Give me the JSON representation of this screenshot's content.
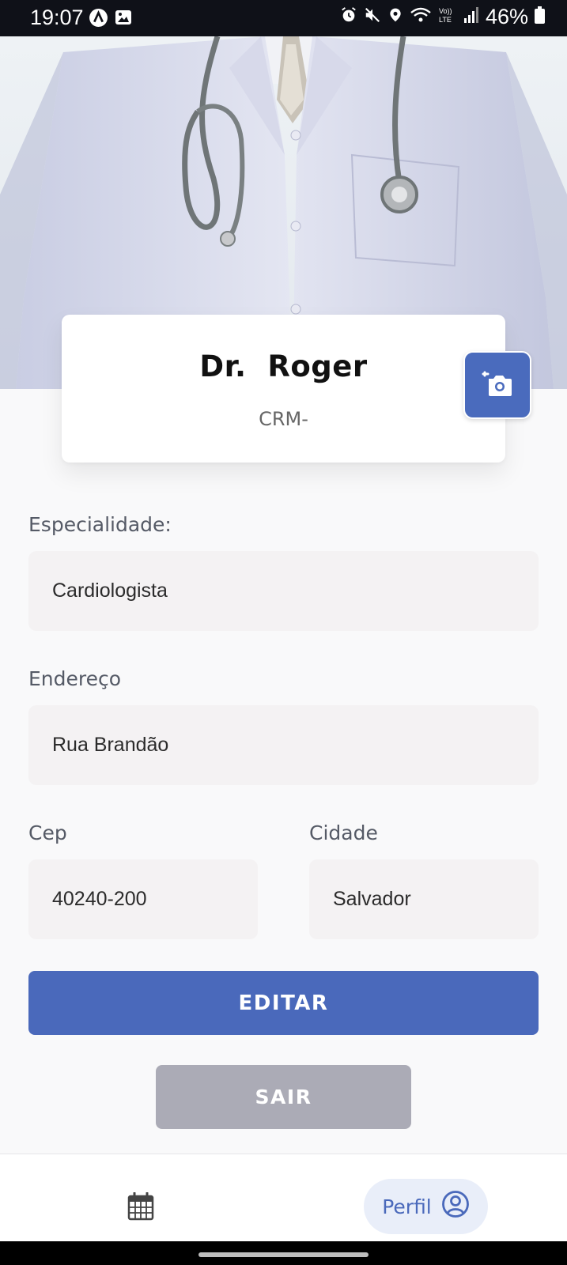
{
  "status_bar": {
    "time": "19:07",
    "battery": "46%",
    "icons": [
      "a-badge-icon",
      "image-icon",
      "alarm-icon",
      "mute-icon",
      "location-icon",
      "wifi-icon",
      "volte-icon",
      "signal-icon",
      "battery-icon"
    ]
  },
  "hero": {
    "image": "doctor-coat-stethoscope-photo"
  },
  "profile": {
    "name": "Dr.  Roger",
    "crm": "CRM-",
    "photo_button_icon": "add-photo-camera-icon"
  },
  "form": {
    "especialidade": {
      "label": "Especialidade:",
      "value": "Cardiologista"
    },
    "endereco": {
      "label": "Endereço",
      "value": "Rua Brandão"
    },
    "cep": {
      "label": "Cep",
      "value": "40240-200"
    },
    "cidade": {
      "label": "Cidade",
      "value": "Salvador"
    }
  },
  "actions": {
    "edit_label": "EDITAR",
    "logout_label": "SAIR"
  },
  "bottom_nav": {
    "calendar_icon": "calendar-icon",
    "profile_label": "Perfil",
    "profile_icon": "user-circle-icon"
  },
  "colors": {
    "primary": "#4a69bb",
    "secondary_button": "#ababb6",
    "input_bg": "#f4f2f3",
    "page_bg": "#f9f9fa"
  }
}
